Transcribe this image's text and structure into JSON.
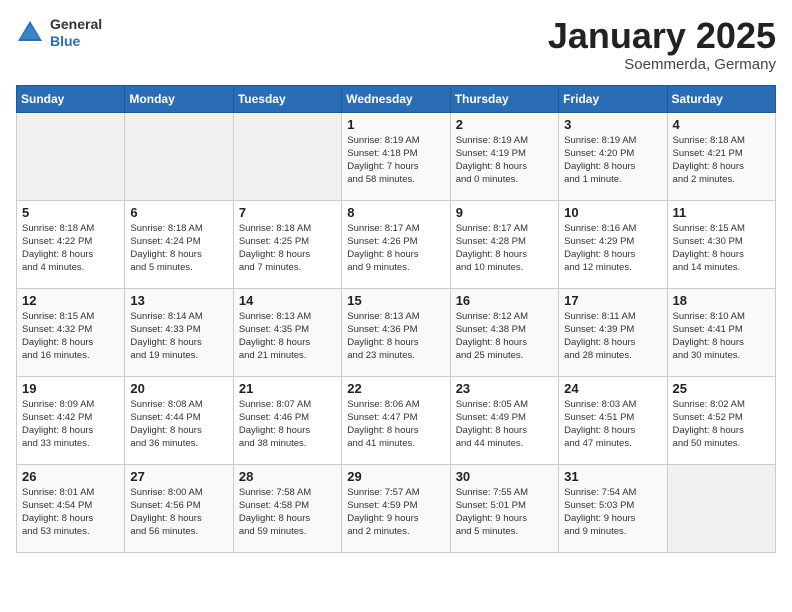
{
  "logo": {
    "general": "General",
    "blue": "Blue"
  },
  "header": {
    "month": "January 2025",
    "location": "Soemmerda, Germany"
  },
  "weekdays": [
    "Sunday",
    "Monday",
    "Tuesday",
    "Wednesday",
    "Thursday",
    "Friday",
    "Saturday"
  ],
  "weeks": [
    [
      {
        "day": "",
        "info": ""
      },
      {
        "day": "",
        "info": ""
      },
      {
        "day": "",
        "info": ""
      },
      {
        "day": "1",
        "info": "Sunrise: 8:19 AM\nSunset: 4:18 PM\nDaylight: 7 hours\nand 58 minutes."
      },
      {
        "day": "2",
        "info": "Sunrise: 8:19 AM\nSunset: 4:19 PM\nDaylight: 8 hours\nand 0 minutes."
      },
      {
        "day": "3",
        "info": "Sunrise: 8:19 AM\nSunset: 4:20 PM\nDaylight: 8 hours\nand 1 minute."
      },
      {
        "day": "4",
        "info": "Sunrise: 8:18 AM\nSunset: 4:21 PM\nDaylight: 8 hours\nand 2 minutes."
      }
    ],
    [
      {
        "day": "5",
        "info": "Sunrise: 8:18 AM\nSunset: 4:22 PM\nDaylight: 8 hours\nand 4 minutes."
      },
      {
        "day": "6",
        "info": "Sunrise: 8:18 AM\nSunset: 4:24 PM\nDaylight: 8 hours\nand 5 minutes."
      },
      {
        "day": "7",
        "info": "Sunrise: 8:18 AM\nSunset: 4:25 PM\nDaylight: 8 hours\nand 7 minutes."
      },
      {
        "day": "8",
        "info": "Sunrise: 8:17 AM\nSunset: 4:26 PM\nDaylight: 8 hours\nand 9 minutes."
      },
      {
        "day": "9",
        "info": "Sunrise: 8:17 AM\nSunset: 4:28 PM\nDaylight: 8 hours\nand 10 minutes."
      },
      {
        "day": "10",
        "info": "Sunrise: 8:16 AM\nSunset: 4:29 PM\nDaylight: 8 hours\nand 12 minutes."
      },
      {
        "day": "11",
        "info": "Sunrise: 8:15 AM\nSunset: 4:30 PM\nDaylight: 8 hours\nand 14 minutes."
      }
    ],
    [
      {
        "day": "12",
        "info": "Sunrise: 8:15 AM\nSunset: 4:32 PM\nDaylight: 8 hours\nand 16 minutes."
      },
      {
        "day": "13",
        "info": "Sunrise: 8:14 AM\nSunset: 4:33 PM\nDaylight: 8 hours\nand 19 minutes."
      },
      {
        "day": "14",
        "info": "Sunrise: 8:13 AM\nSunset: 4:35 PM\nDaylight: 8 hours\nand 21 minutes."
      },
      {
        "day": "15",
        "info": "Sunrise: 8:13 AM\nSunset: 4:36 PM\nDaylight: 8 hours\nand 23 minutes."
      },
      {
        "day": "16",
        "info": "Sunrise: 8:12 AM\nSunset: 4:38 PM\nDaylight: 8 hours\nand 25 minutes."
      },
      {
        "day": "17",
        "info": "Sunrise: 8:11 AM\nSunset: 4:39 PM\nDaylight: 8 hours\nand 28 minutes."
      },
      {
        "day": "18",
        "info": "Sunrise: 8:10 AM\nSunset: 4:41 PM\nDaylight: 8 hours\nand 30 minutes."
      }
    ],
    [
      {
        "day": "19",
        "info": "Sunrise: 8:09 AM\nSunset: 4:42 PM\nDaylight: 8 hours\nand 33 minutes."
      },
      {
        "day": "20",
        "info": "Sunrise: 8:08 AM\nSunset: 4:44 PM\nDaylight: 8 hours\nand 36 minutes."
      },
      {
        "day": "21",
        "info": "Sunrise: 8:07 AM\nSunset: 4:46 PM\nDaylight: 8 hours\nand 38 minutes."
      },
      {
        "day": "22",
        "info": "Sunrise: 8:06 AM\nSunset: 4:47 PM\nDaylight: 8 hours\nand 41 minutes."
      },
      {
        "day": "23",
        "info": "Sunrise: 8:05 AM\nSunset: 4:49 PM\nDaylight: 8 hours\nand 44 minutes."
      },
      {
        "day": "24",
        "info": "Sunrise: 8:03 AM\nSunset: 4:51 PM\nDaylight: 8 hours\nand 47 minutes."
      },
      {
        "day": "25",
        "info": "Sunrise: 8:02 AM\nSunset: 4:52 PM\nDaylight: 8 hours\nand 50 minutes."
      }
    ],
    [
      {
        "day": "26",
        "info": "Sunrise: 8:01 AM\nSunset: 4:54 PM\nDaylight: 8 hours\nand 53 minutes."
      },
      {
        "day": "27",
        "info": "Sunrise: 8:00 AM\nSunset: 4:56 PM\nDaylight: 8 hours\nand 56 minutes."
      },
      {
        "day": "28",
        "info": "Sunrise: 7:58 AM\nSunset: 4:58 PM\nDaylight: 8 hours\nand 59 minutes."
      },
      {
        "day": "29",
        "info": "Sunrise: 7:57 AM\nSunset: 4:59 PM\nDaylight: 9 hours\nand 2 minutes."
      },
      {
        "day": "30",
        "info": "Sunrise: 7:55 AM\nSunset: 5:01 PM\nDaylight: 9 hours\nand 5 minutes."
      },
      {
        "day": "31",
        "info": "Sunrise: 7:54 AM\nSunset: 5:03 PM\nDaylight: 9 hours\nand 9 minutes."
      },
      {
        "day": "",
        "info": ""
      }
    ]
  ]
}
